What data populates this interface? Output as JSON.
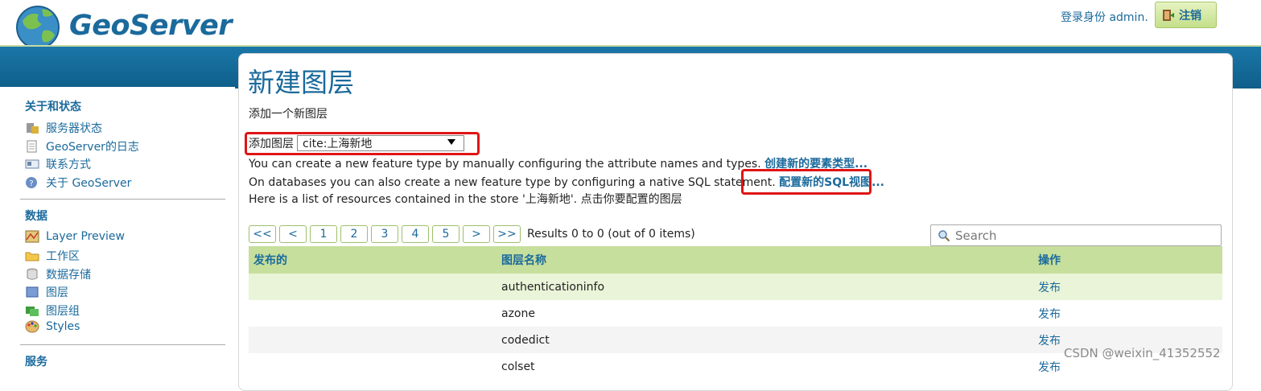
{
  "header": {
    "logo_text": "GeoServer",
    "login_text": "登录身份 admin.",
    "logout_label": "注销"
  },
  "sidebar": {
    "sections": [
      {
        "title": "关于和状态",
        "items": [
          "服务器状态",
          "GeoServer的日志",
          "联系方式",
          "关于 GeoServer"
        ]
      },
      {
        "title": "数据",
        "items": [
          "Layer Preview",
          "工作区",
          "数据存储",
          "图层",
          "图层组",
          "Styles"
        ]
      },
      {
        "title": "服务",
        "items": []
      }
    ]
  },
  "main": {
    "title": "新建图层",
    "subtitle": "添加一个新图层",
    "add_layer_label": "添加图层",
    "store_selected": "cite:上海新地",
    "info1_text": "You can create a new feature type by manually configuring the attribute names and types. ",
    "info1_link": "创建新的要素类型...",
    "info2_text": "On databases you can also create a new feature type by configuring a native SQL statement. ",
    "info2_link": "配置新的SQL视图...",
    "info3_text": "Here is a list of resources contained in the store '上海新地'. 点击你要配置的图层"
  },
  "pager": {
    "buttons": [
      "<<",
      "<",
      "1",
      "2",
      "3",
      "4",
      "5",
      ">",
      ">>"
    ],
    "results": "Results 0 to 0 (out of 0 items)",
    "search_placeholder": "Search"
  },
  "table": {
    "headers": [
      "发布的",
      "图层名称",
      "操作"
    ],
    "rows": [
      {
        "published": "",
        "name": "authenticationinfo",
        "action": "发布"
      },
      {
        "published": "",
        "name": "azone",
        "action": "发布"
      },
      {
        "published": "",
        "name": "codedict",
        "action": "发布"
      },
      {
        "published": "",
        "name": "colset",
        "action": "发布"
      }
    ]
  },
  "watermark": "CSDN @weixin_41352552",
  "colors": {
    "brand_blue": "#1b6a9c",
    "table_header": "#c6df9c",
    "highlight_red": "#e01515"
  }
}
